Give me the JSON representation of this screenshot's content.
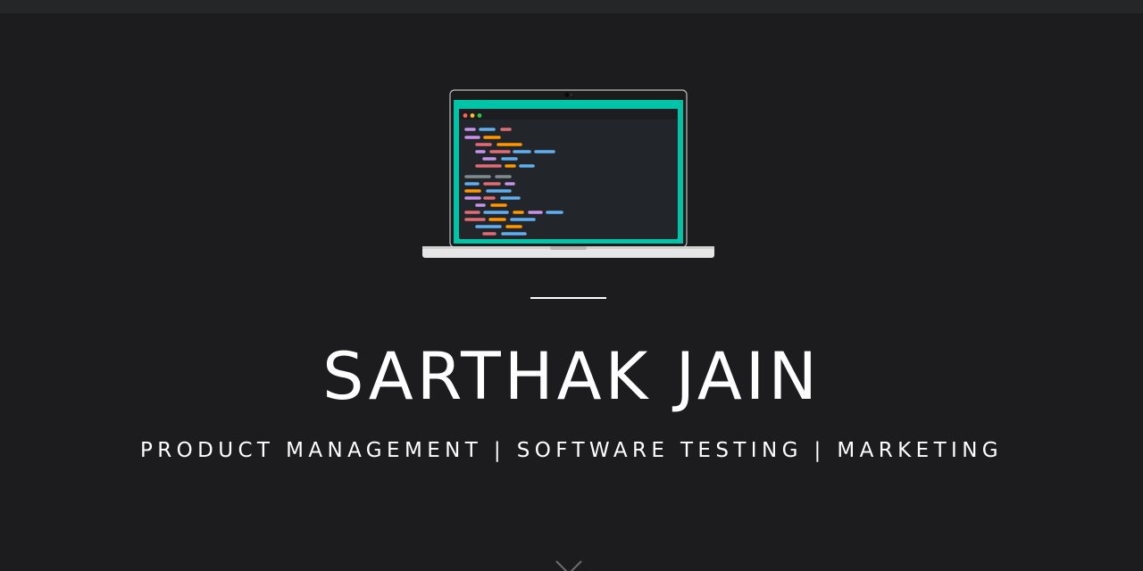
{
  "hero": {
    "name": "SARTHAK JAIN",
    "tagline": "PRODUCT MANAGEMENT | SOFTWARE TESTING | MARKETING",
    "illustration_icon": "laptop-code-icon",
    "scroll_icon": "chevron-down-icon"
  },
  "colors": {
    "background": "#1c1c1e",
    "top_bar": "#252628",
    "text": "#ffffff",
    "screen_accent": "#00c4a7",
    "code_editor": "#22252a",
    "syntax": [
      "#c792ea",
      "#61afef",
      "#e06c75",
      "#ff9800",
      "#7f8c8d"
    ]
  }
}
